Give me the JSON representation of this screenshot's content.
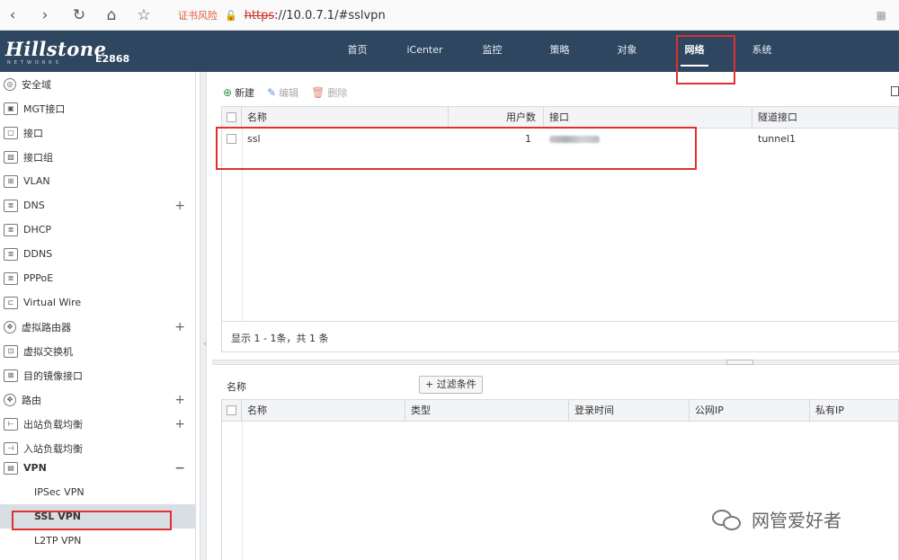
{
  "browser": {
    "back": "‹",
    "forward": "›",
    "reload": "↻",
    "home": "⌂",
    "star": "☆",
    "cert_warning": "证书风险",
    "url_scheme": "https",
    "url_rest": "://10.0.7.1/#sslvpn",
    "grid": "▦"
  },
  "header": {
    "logo": "Hillstone",
    "logo_sub": "NETWORKS",
    "model": "E2868",
    "nav": [
      {
        "label": "首页"
      },
      {
        "label": "iCenter"
      },
      {
        "label": "监控"
      },
      {
        "label": "策略"
      },
      {
        "label": "对象"
      },
      {
        "label": "网络"
      },
      {
        "label": "系统"
      }
    ],
    "active_nav": "网络"
  },
  "sidebar": {
    "items": [
      {
        "label": "安全域",
        "icon": "◎",
        "expandable": false
      },
      {
        "label": "MGT接口",
        "icon": "▣",
        "expandable": false
      },
      {
        "label": "接口",
        "icon": "▢",
        "expandable": false
      },
      {
        "label": "接口组",
        "icon": "▧",
        "expandable": false
      },
      {
        "label": "VLAN",
        "icon": "⊞",
        "expandable": false
      },
      {
        "label": "DNS",
        "icon": "≣",
        "expandable": true
      },
      {
        "label": "DHCP",
        "icon": "≣",
        "expandable": false
      },
      {
        "label": "DDNS",
        "icon": "≣",
        "expandable": false
      },
      {
        "label": "PPPoE",
        "icon": "≣",
        "expandable": false
      },
      {
        "label": "Virtual Wire",
        "icon": "⊏",
        "expandable": false
      },
      {
        "label": "虚拟路由器",
        "icon": "✥",
        "expandable": true
      },
      {
        "label": "虚拟交换机",
        "icon": "⊡",
        "expandable": false
      },
      {
        "label": "目的镜像接口",
        "icon": "⊠",
        "expandable": false
      },
      {
        "label": "路由",
        "icon": "✥",
        "expandable": true
      },
      {
        "label": "出站负载均衡",
        "icon": "⊢",
        "expandable": true
      },
      {
        "label": "入站负载均衡",
        "icon": "⊣",
        "expandable": false
      },
      {
        "label": "VPN",
        "icon": "▤",
        "expandable": true,
        "expanded": true
      }
    ],
    "collapse_symbol": "−",
    "expand_symbol": "+",
    "vpn_children": [
      {
        "label": "IPSec VPN"
      },
      {
        "label": "SSL VPN",
        "selected": true
      },
      {
        "label": "L2TP VPN"
      }
    ]
  },
  "toolbar": {
    "new_label": "新建",
    "edit_label": "编辑",
    "delete_label": "删除"
  },
  "vpn_table": {
    "columns": [
      "名称",
      "用户数",
      "接口",
      "隧道接口"
    ],
    "rows": [
      {
        "name": "ssl",
        "users": "1",
        "interface_blurred": true,
        "tunnel": "tunnel1"
      }
    ],
    "footer": "显示 1 - 1条，共 1 条"
  },
  "filter": {
    "label": "名称",
    "button": "+ 过滤条件"
  },
  "session_table": {
    "columns": [
      "名称",
      "类型",
      "登录时间",
      "公网IP",
      "私有IP"
    ]
  },
  "watermark": {
    "text": "网管爱好者"
  },
  "colors": {
    "header_bg": "#2e4660",
    "highlight_red": "#e03030",
    "selected_bg": "#d9dde4"
  }
}
